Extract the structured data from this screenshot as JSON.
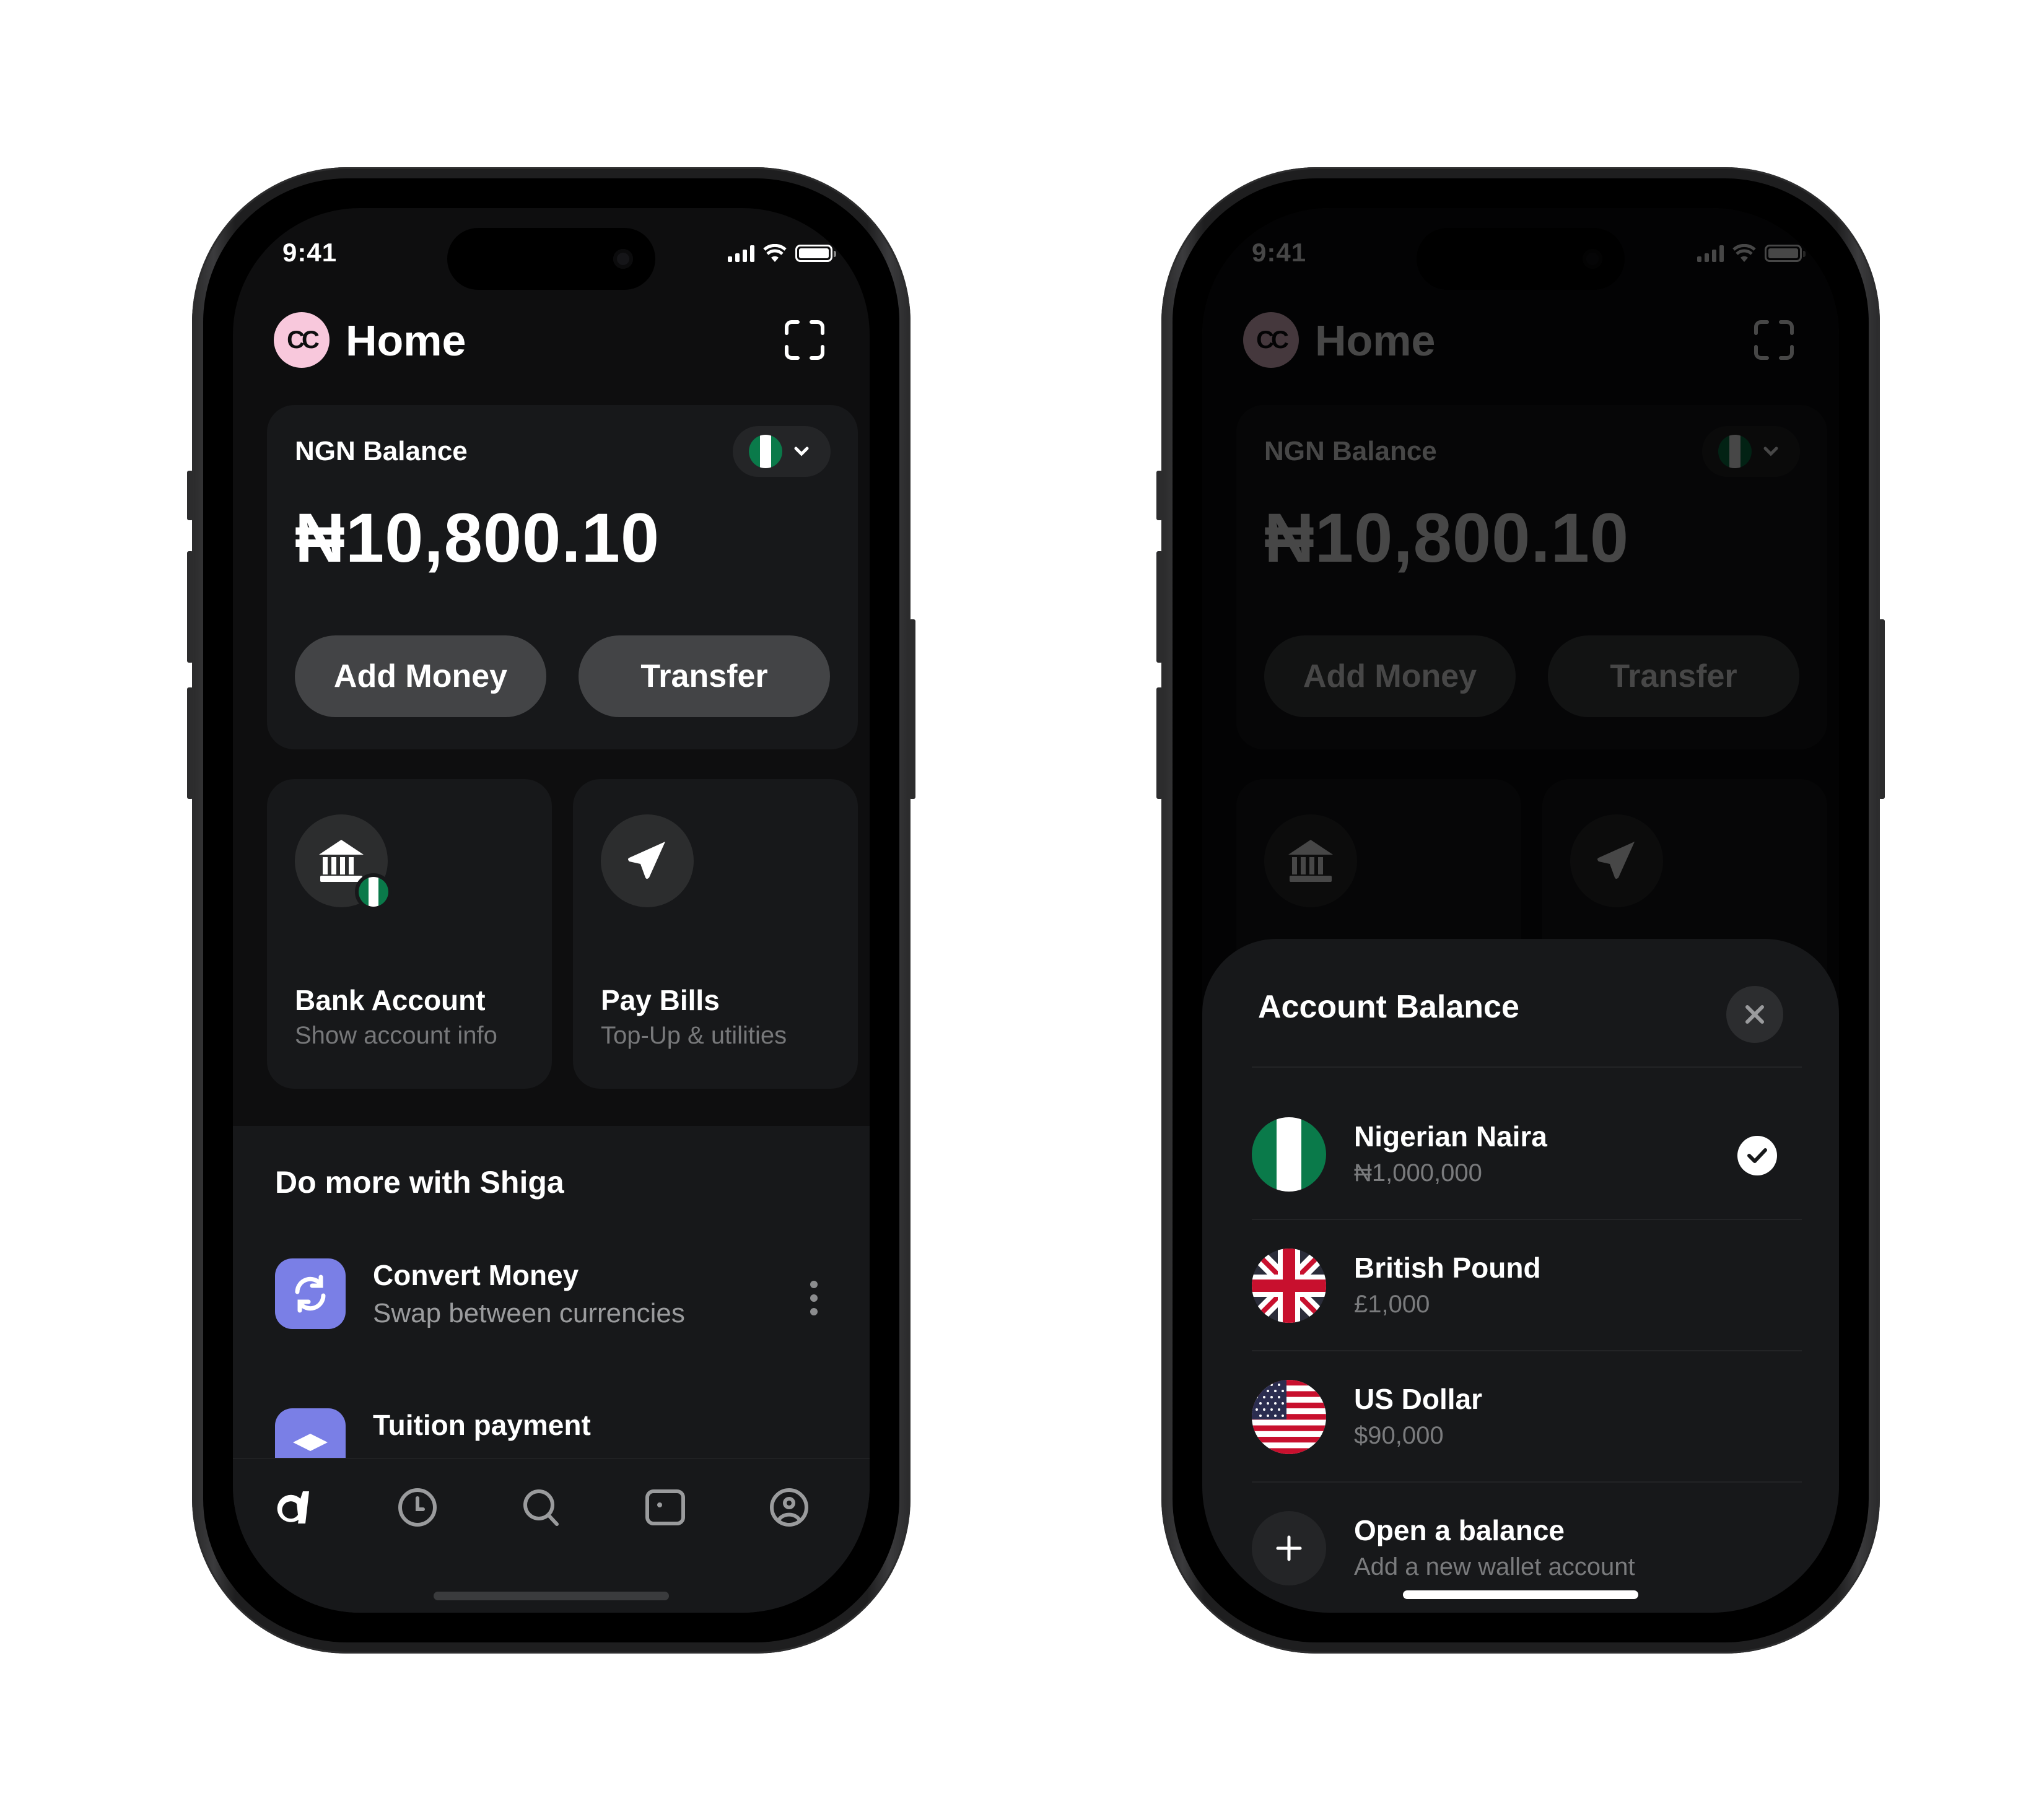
{
  "status_bar": {
    "time": "9:41",
    "icons": [
      "cellular-signal-icon",
      "wifi-icon",
      "battery-icon"
    ]
  },
  "header": {
    "avatar_initials": "CC",
    "title": "Home",
    "action_icon": "scan-icon"
  },
  "balance_card": {
    "label": "NGN Balance",
    "currency_selector": {
      "flag": "nigeria-flag",
      "icon": "chevron-down-icon"
    },
    "amount": "₦10,800.10",
    "buttons": {
      "add_money": "Add Money",
      "transfer": "Transfer"
    }
  },
  "quick_actions": [
    {
      "title": "Bank Account",
      "subtitle": "Show account info",
      "icon": "bank-icon",
      "badge": "nigeria-flag"
    },
    {
      "title": "Pay Bills",
      "subtitle": "Top-Up & utilities",
      "icon": "send-icon"
    }
  ],
  "more_section": {
    "title": "Do more with Shiga",
    "items": [
      {
        "title": "Convert Money",
        "subtitle": "Swap between currencies",
        "icon": "refresh-icon"
      },
      {
        "title": "Tuition payment",
        "subtitle": "",
        "icon": "graduation-cap-icon"
      }
    ]
  },
  "tab_bar": [
    {
      "name": "home",
      "icon": "shiga-logo-icon",
      "active": true
    },
    {
      "name": "history",
      "icon": "clock-icon",
      "active": false
    },
    {
      "name": "search",
      "icon": "search-icon",
      "active": false
    },
    {
      "name": "cards",
      "icon": "card-icon",
      "active": false
    },
    {
      "name": "profile",
      "icon": "user-circle-icon",
      "active": false
    }
  ],
  "account_sheet": {
    "title": "Account Balance",
    "close_icon": "close-icon",
    "accounts": [
      {
        "name": "Nigerian Naira",
        "balance": "₦1,000,000",
        "flag": "nigeria-flag",
        "selected": true
      },
      {
        "name": "British Pound",
        "balance": "£1,000",
        "flag": "uk-flag",
        "selected": false
      },
      {
        "name": "US Dollar",
        "balance": "$90,000",
        "flag": "us-flag",
        "selected": false
      }
    ],
    "open_balance": {
      "title": "Open a balance",
      "subtitle": "Add a new wallet account"
    }
  },
  "colors": {
    "accent_pink": "#f8c8dc",
    "app_purple": "#7a7fe6",
    "ng_green": "#0a7a4a",
    "card_bg": "#17181a",
    "button_bg": "#434446"
  }
}
